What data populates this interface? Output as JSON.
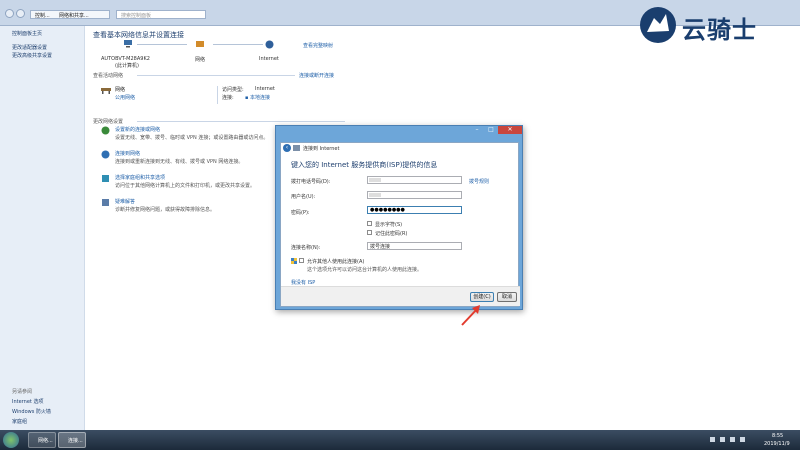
{
  "address_bar": {
    "crumbs": [
      "控制...",
      "网络和共享..."
    ],
    "search_placeholder": "搜索控制面板"
  },
  "left_nav": {
    "items": [
      "控制面板主页",
      "更改适配器设置",
      "更改高级共享设置"
    ],
    "see_also_title": "另请参阅",
    "see_also": [
      "Internet 选项",
      "Windows 防火墙",
      "家庭组"
    ]
  },
  "main": {
    "title": "查看基本网络信息并设置连接",
    "map": {
      "computer_name": "AUTOBVT-M28A9K2",
      "computer_sub": "(此计算机)",
      "network": "网络",
      "internet": "Internet",
      "view_full_map": "查看完整映射"
    },
    "active_networks_title": "查看活动网络",
    "connect_disconnect": "连接或断开连接",
    "network_name": "网络",
    "network_type": "公用网络",
    "access_type_label": "访问类型:",
    "access_type_value": "Internet",
    "connections_label": "连接:",
    "connections_value": "本地连接",
    "change_settings_title": "更改网络设置",
    "tasks": [
      {
        "title": "设置新的连接或网络",
        "desc": "设置无线、宽带、拨号、临时或 VPN 连接；或设置路由器或访问点。"
      },
      {
        "title": "连接到网络",
        "desc": "连接到或重新连接到无线、有线、拨号或 VPN 网络连接。"
      },
      {
        "title": "选择家庭组和共享选项",
        "desc": "访问位于其他网络计算机上的文件和打印机，或更改共享设置。"
      },
      {
        "title": "疑难解答",
        "desc": "诊断并修复网络问题，或获得故障排除信息。"
      }
    ]
  },
  "dialog": {
    "title": "连接到 Internet",
    "heading": "键入您的 Internet 服务提供商(ISP)提供的信息",
    "phone_label": "拨打电话号码(D):",
    "phone_value": "",
    "dialing_rules": "拨号规则",
    "username_label": "用户名(U):",
    "username_value": "",
    "password_label": "密码(P):",
    "password_value": "●●●●●●●●",
    "show_chars": "显示字符(S)",
    "remember_password": "记住此密码(R)",
    "connection_name_label": "连接名称(N):",
    "connection_name_value": "拨号连接",
    "allow_others": "允许其他人使用此连接(A)",
    "allow_others_desc": "这个选项允许可以访问这台计算机的人使用此连接。",
    "no_isp": "我没有 ISP",
    "create_button": "创建(C)",
    "cancel_button": "取消"
  },
  "taskbar": {
    "items": [
      "网络...",
      "连接..."
    ],
    "time": "8:55",
    "date": "2019/11/9"
  },
  "logo": {
    "text": "云骑士"
  },
  "colors": {
    "accent": "#1e5fa8",
    "arrow": "#e23b2e",
    "dialog_frame": "#6da6d9"
  }
}
